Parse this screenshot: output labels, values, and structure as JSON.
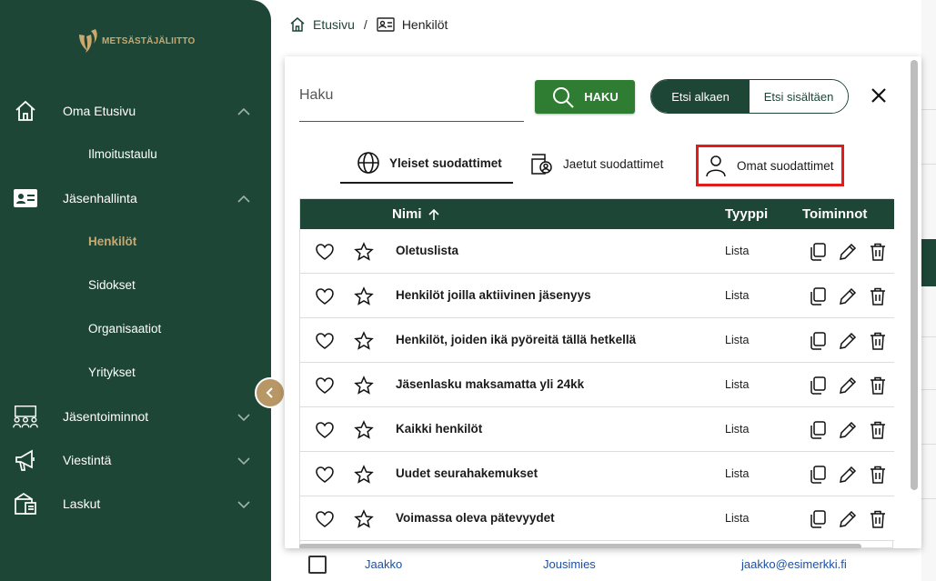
{
  "logo": {
    "text": "METSÄSTÄJÄLIITTO"
  },
  "sidebar": {
    "items": [
      {
        "label": "Oma Etusivu",
        "icon": "home-icon",
        "chevron": "up"
      },
      {
        "label": "Jäsenhallinta",
        "icon": "id-card-icon",
        "chevron": "up"
      },
      {
        "label": "Jäsentoiminnot",
        "icon": "group-icon",
        "chevron": "down"
      },
      {
        "label": "Viestintä",
        "icon": "megaphone-icon",
        "chevron": "down"
      },
      {
        "label": "Laskut",
        "icon": "invoice-icon",
        "chevron": "down"
      }
    ],
    "sub_items": {
      "oma_etusivu": [
        "Ilmoitustaulu"
      ],
      "jasenhallinta": [
        "Henkilöt",
        "Sidokset",
        "Organisaatiot",
        "Yritykset"
      ]
    },
    "active_sub": "Henkilöt"
  },
  "breadcrumb": {
    "home": "Etusivu",
    "separator": "/",
    "current": "Henkilöt"
  },
  "modal": {
    "search": {
      "placeholder": "Haku",
      "value": ""
    },
    "search_button": "HAKU",
    "toggle": {
      "left": "Etsi alkaen",
      "right": "Etsi sisältäen",
      "selected": "Etsi alkaen"
    },
    "tabs": [
      {
        "label": "Yleiset suodattimet",
        "icon": "globe-icon",
        "active": true
      },
      {
        "label": "Jaetut suodattimet",
        "icon": "shared-user-icon",
        "active": false
      },
      {
        "label": "Omat suodattimet",
        "icon": "user-icon",
        "active": false,
        "highlighted": true
      }
    ],
    "table": {
      "headers": {
        "name": "Nimi",
        "type": "Tyyppi",
        "actions": "Toiminnot"
      },
      "sort": "ascending",
      "rows": [
        {
          "name": "Oletuslista",
          "type": "Lista"
        },
        {
          "name": "Henkilöt joilla aktiivinen jäsenyys",
          "type": "Lista"
        },
        {
          "name": "Henkilöt, joiden ikä pyöreitä tällä hetkellä",
          "type": "Lista"
        },
        {
          "name": "Jäsenlasku maksamatta yli 24kk",
          "type": "Lista"
        },
        {
          "name": "Kaikki henkilöt",
          "type": "Lista"
        },
        {
          "name": "Uudet seurahakemukset",
          "type": "Lista"
        },
        {
          "name": "Voimassa oleva pätevyydet",
          "type": "Lista"
        }
      ]
    }
  },
  "background_row": {
    "first_name": "Jaakko",
    "last_name": "Jousimies",
    "email": "jaakko@esimerkki.fi"
  },
  "colors": {
    "sidebar": "#1d4637",
    "accent_gold": "#c9a96e",
    "search_button": "#2e7d32",
    "highlight": "#e41b1b"
  }
}
